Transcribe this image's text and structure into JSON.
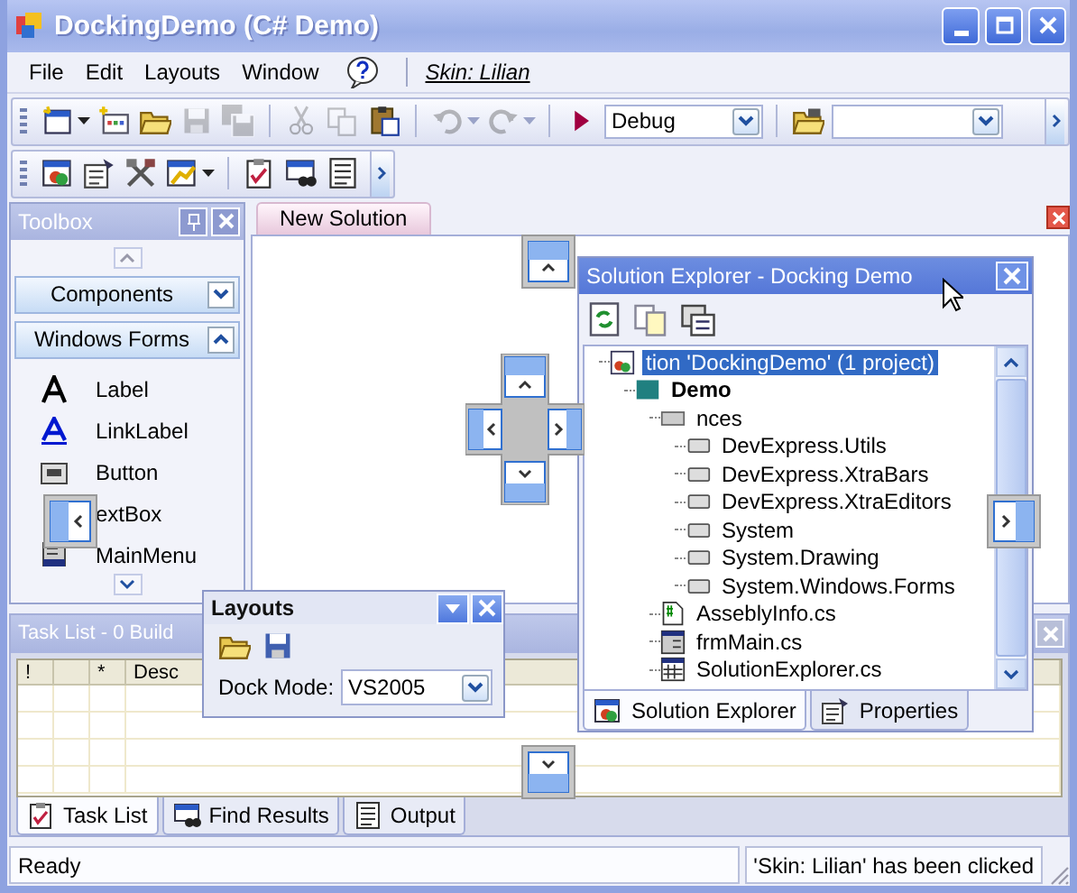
{
  "window": {
    "title": "DockingDemo (C# Demo)"
  },
  "menu": {
    "items": [
      {
        "label": "File"
      },
      {
        "label": "Edit"
      },
      {
        "label": "Layouts"
      },
      {
        "label": "Window"
      }
    ],
    "skin_link": "Skin: Lilian"
  },
  "toolbar": {
    "buttons": [
      {
        "kind": "new-project",
        "disabled": false,
        "has_menu": true
      },
      {
        "kind": "add-item",
        "disabled": false,
        "has_menu": false
      },
      {
        "kind": "open",
        "disabled": false,
        "has_menu": false
      },
      {
        "kind": "save",
        "disabled": true,
        "has_menu": false
      },
      {
        "kind": "save-all",
        "disabled": true,
        "has_menu": false,
        "separator_after": true
      },
      {
        "kind": "cut",
        "disabled": true,
        "has_menu": false
      },
      {
        "kind": "copy",
        "disabled": true,
        "has_menu": false
      },
      {
        "kind": "paste",
        "disabled": false,
        "has_menu": false,
        "separator_after": true
      },
      {
        "kind": "undo",
        "disabled": true,
        "has_menu": true
      },
      {
        "kind": "redo",
        "disabled": true,
        "has_menu": true,
        "separator_after": true
      },
      {
        "kind": "start",
        "disabled": false,
        "has_menu": false
      }
    ],
    "configuration": "Debug",
    "after_buttons": [
      {
        "kind": "find-folder",
        "disabled": false,
        "has_menu": false
      }
    ]
  },
  "toolbar2": {
    "buttons": [
      {
        "kind": "solution",
        "disabled": false,
        "has_menu": false
      },
      {
        "kind": "properties",
        "disabled": false,
        "has_menu": false
      },
      {
        "kind": "tools",
        "disabled": false,
        "has_menu": false
      },
      {
        "kind": "graph",
        "disabled": false,
        "has_menu": true,
        "separator_after": true
      },
      {
        "kind": "tasks",
        "disabled": false,
        "has_menu": false
      },
      {
        "kind": "find",
        "disabled": false,
        "has_menu": false
      },
      {
        "kind": "output",
        "disabled": false,
        "has_menu": false
      }
    ]
  },
  "toolbox": {
    "title": "Toolbox",
    "groups": [
      {
        "label": "Components",
        "expanded": false
      },
      {
        "label": "Windows Forms",
        "expanded": true
      }
    ],
    "items": [
      {
        "kind": "label",
        "label": "Label"
      },
      {
        "kind": "linklabel",
        "label": "LinkLabel"
      },
      {
        "kind": "button",
        "label": "Button"
      },
      {
        "kind": "textbox",
        "label": "extBox"
      },
      {
        "kind": "mainmenu",
        "label": "MainMenu"
      }
    ]
  },
  "document_tabs": [
    {
      "label": "New Solution",
      "selected": true
    }
  ],
  "solution_explorer": {
    "title": "Solution Explorer - Docking Demo",
    "tree": [
      {
        "kind": "solution",
        "label": "tion 'DockingDemo' (1 project)",
        "selected": true,
        "children": [
          {
            "kind": "project",
            "label": "Demo",
            "selected": false,
            "children": [
              {
                "kind": "references",
                "label": "nces",
                "selected": false,
                "children": [
                  {
                    "kind": "reference",
                    "label": "DevExpress.Utils",
                    "selected": false
                  },
                  {
                    "kind": "reference",
                    "label": "DevExpress.XtraBars",
                    "selected": false
                  },
                  {
                    "kind": "reference",
                    "label": "DevExpress.XtraEditors",
                    "selected": false
                  },
                  {
                    "kind": "reference",
                    "label": "System",
                    "selected": false
                  },
                  {
                    "kind": "reference",
                    "label": "System.Drawing",
                    "selected": false
                  },
                  {
                    "kind": "reference",
                    "label": "System.Windows.Forms",
                    "selected": false
                  }
                ]
              },
              {
                "kind": "code",
                "label": "AsseblyInfo.cs",
                "selected": false
              },
              {
                "kind": "form",
                "label": "frmMain.cs",
                "selected": false
              },
              {
                "kind": "class",
                "label": "SolutionExplorer.cs",
                "selected": false
              }
            ]
          }
        ]
      }
    ],
    "tabs": [
      {
        "kind": "solution",
        "label": "Solution Explorer",
        "selected": true
      },
      {
        "kind": "properties",
        "label": "Properties",
        "selected": false
      }
    ]
  },
  "task_list": {
    "title": "Task List - 0 Build",
    "columns": [
      {
        "label": "!"
      },
      {},
      {
        "label": "*"
      },
      {
        "label": "Desc"
      }
    ],
    "tabs": [
      {
        "kind": "tasks",
        "label": "Task List",
        "selected": true
      },
      {
        "kind": "find",
        "label": "Find Results",
        "selected": false
      },
      {
        "kind": "output",
        "label": "Output",
        "selected": false
      }
    ]
  },
  "layouts": {
    "title": "Layouts",
    "dock_mode_label": "Dock Mode:",
    "dock_mode": "VS2005"
  },
  "status_bar": {
    "message": "Ready",
    "notice": "'Skin: Lilian' has been clicked"
  }
}
